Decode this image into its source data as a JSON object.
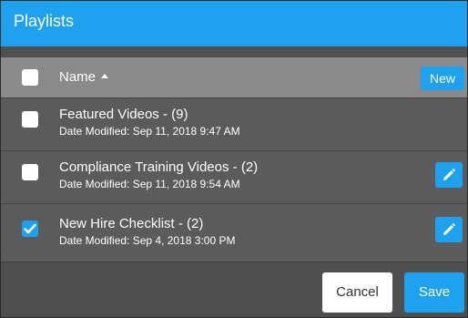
{
  "dialog": {
    "title": "Playlists"
  },
  "header": {
    "column_name": "Name",
    "sort_icon": "sort-ascending-icon",
    "new_label": "New",
    "select_all_checked": false
  },
  "rows": [
    {
      "name": "Featured Videos - (9)",
      "date_modified": "Date Modified: Sep 11, 2018 9:47 AM",
      "checked": false,
      "has_edit": false
    },
    {
      "name": "Compliance Training Videos - (2)",
      "date_modified": "Date Modified: Sep 11, 2018 9:54 AM",
      "checked": false,
      "has_edit": true
    },
    {
      "name": "New Hire Checklist - (2)",
      "date_modified": "Date Modified: Sep 4, 2018 3:00 PM",
      "checked": true,
      "has_edit": true
    }
  ],
  "footer": {
    "cancel_label": "Cancel",
    "save_label": "Save"
  },
  "colors": {
    "accent": "#1ea1ef",
    "header_row": "#8a8a8a",
    "row_bg": "#5b5b5b",
    "footer_bg": "#4f4f4f"
  },
  "icons": {
    "edit": "pencil-icon",
    "check": "checkmark-icon"
  }
}
